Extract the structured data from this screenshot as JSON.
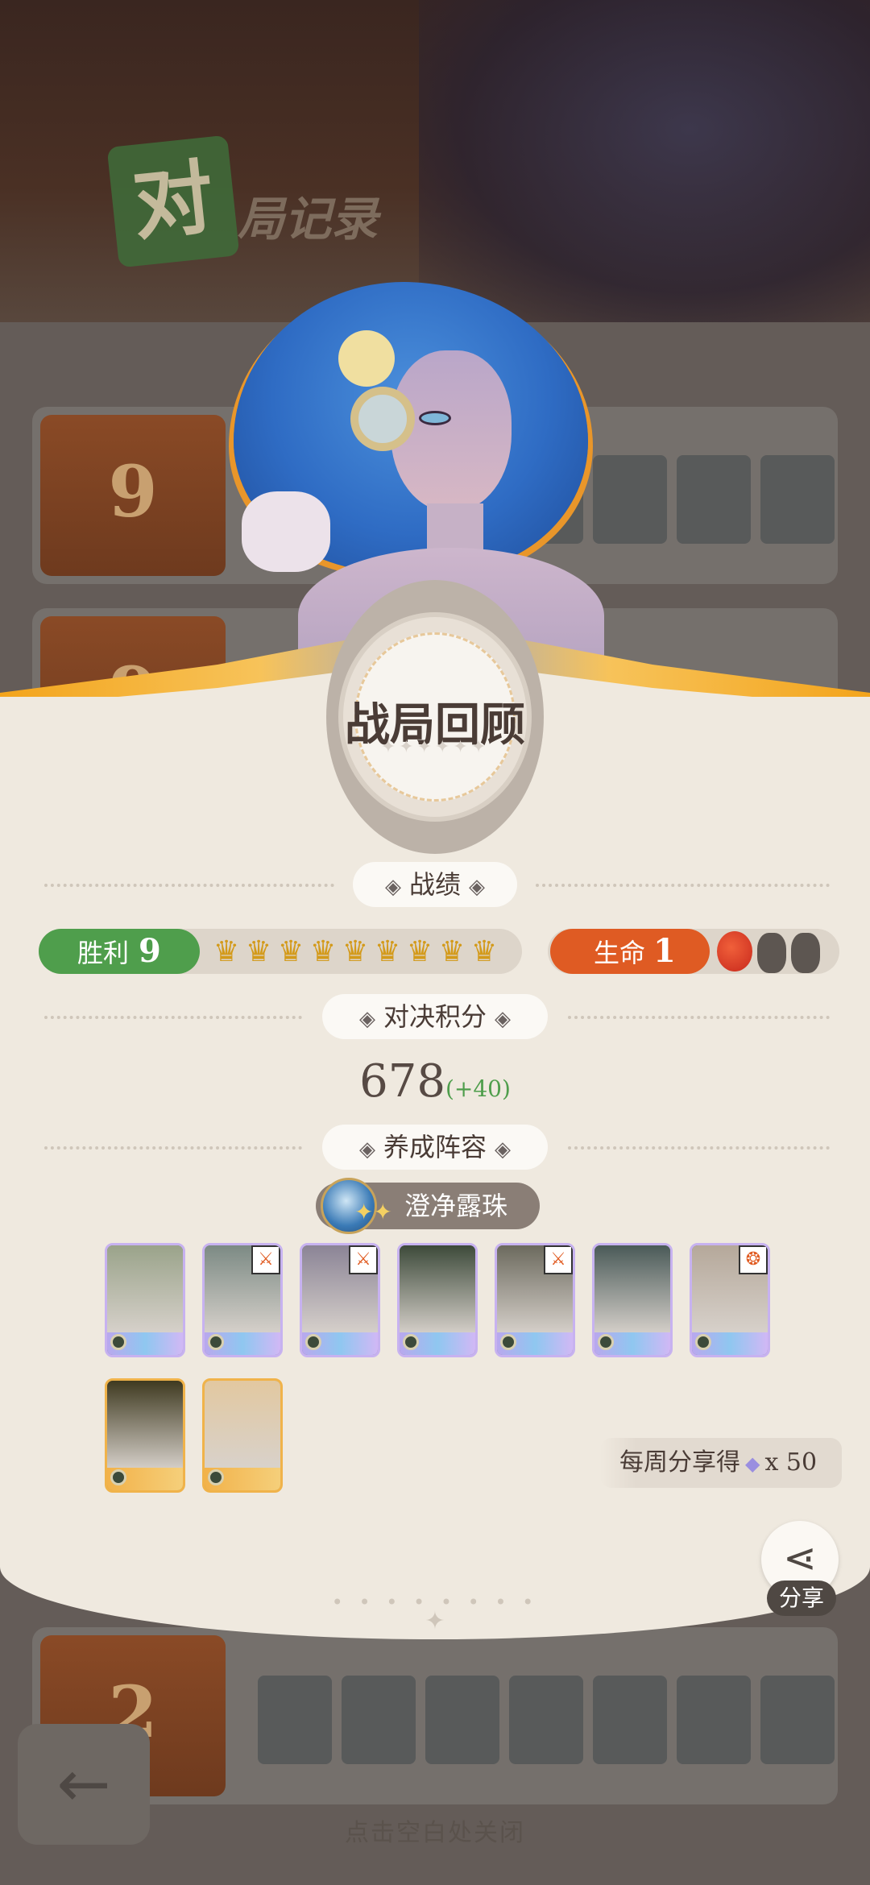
{
  "background": {
    "logo_char": "对",
    "logo_text": "局记录",
    "rows": [
      {
        "rank": "9"
      },
      {
        "rank": "9"
      },
      {
        "rank": "2"
      }
    ],
    "close_hint": "点击空白处关闭"
  },
  "modal": {
    "title": "战局回顾",
    "sections": {
      "record": "战绩",
      "score": "对决积分",
      "lineup": "养成阵容"
    },
    "wins": {
      "label": "胜利",
      "value": "9",
      "trophies": 9
    },
    "life": {
      "label": "生命",
      "value": "1",
      "apples_full": 1,
      "apples_eaten": 2
    },
    "score": {
      "value": "678",
      "delta": "(+40)"
    },
    "lineup_name": "澄净露珠",
    "heroes": [
      {
        "name": "hero-1",
        "tag": "",
        "color": "#9aa38a"
      },
      {
        "name": "hero-2",
        "tag": "⚔",
        "color": "#7c8a84"
      },
      {
        "name": "hero-3",
        "tag": "⚔",
        "color": "#8b8496"
      },
      {
        "name": "hero-4",
        "tag": "",
        "color": "#3d4a3a"
      },
      {
        "name": "hero-5",
        "tag": "⚔",
        "color": "#6c6a5e"
      },
      {
        "name": "hero-6",
        "tag": "",
        "color": "#4a5a58"
      },
      {
        "name": "hero-7",
        "tag": "❂",
        "color": "#b5a89a"
      },
      {
        "name": "hero-8",
        "tag": "",
        "color": "#3f3a20",
        "rarity": "gold"
      },
      {
        "name": "hero-9",
        "tag": "",
        "color": "#e2c8a0",
        "rarity": "gold"
      }
    ],
    "share_note": {
      "prefix": "每周分享得",
      "amount": "x 50"
    },
    "share_label": "分享"
  },
  "colors": {
    "win_green": "#4f9e4c",
    "life_orange": "#df5b23",
    "card_bg": "#efe9df",
    "accent_gold": "#f3a41b"
  }
}
